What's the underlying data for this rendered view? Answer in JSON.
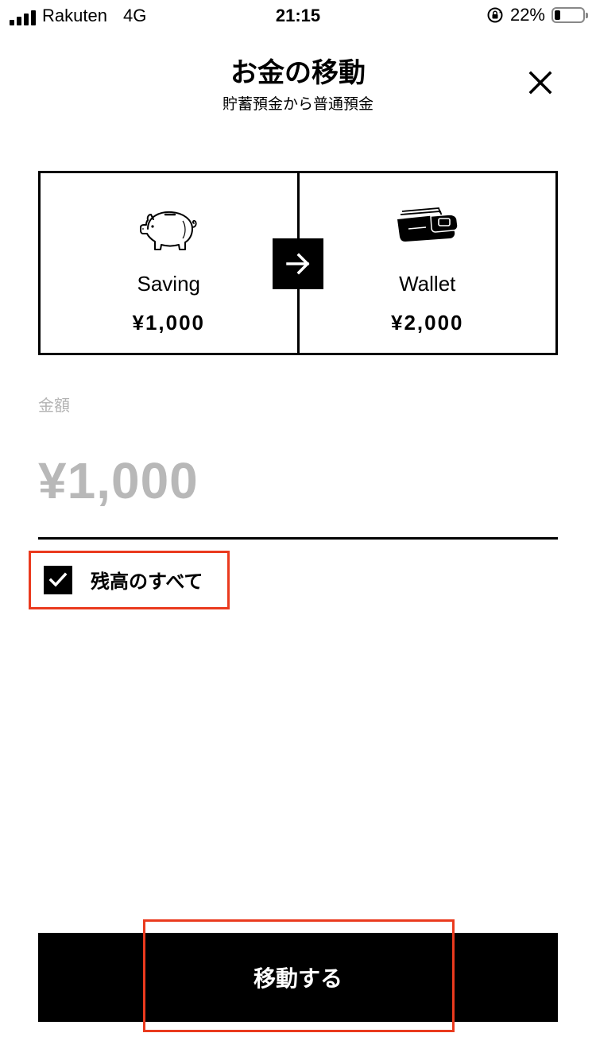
{
  "status_bar": {
    "carrier": "Rakuten",
    "network": "4G",
    "time": "21:15",
    "battery_percent": "22%",
    "battery_level": 0.22
  },
  "header": {
    "title": "お金の移動",
    "subtitle": "貯蓄預金から普通預金",
    "close_icon": "close-icon"
  },
  "transfer": {
    "from": {
      "name": "Saving",
      "amount": "¥1,000",
      "icon": "piggy-bank-icon"
    },
    "to": {
      "name": "Wallet",
      "amount": "¥2,000",
      "icon": "wallet-icon"
    },
    "arrow_icon": "arrow-right-icon"
  },
  "amount_field": {
    "label": "金額",
    "placeholder": "¥1,000",
    "value": ""
  },
  "all_balance": {
    "label": "残高のすべて",
    "checked": true
  },
  "submit": {
    "label": "移動する"
  },
  "colors": {
    "highlight": "#ea3a1e",
    "placeholder_gray": "#b8b8b8",
    "label_gray": "#b3b3b3"
  }
}
